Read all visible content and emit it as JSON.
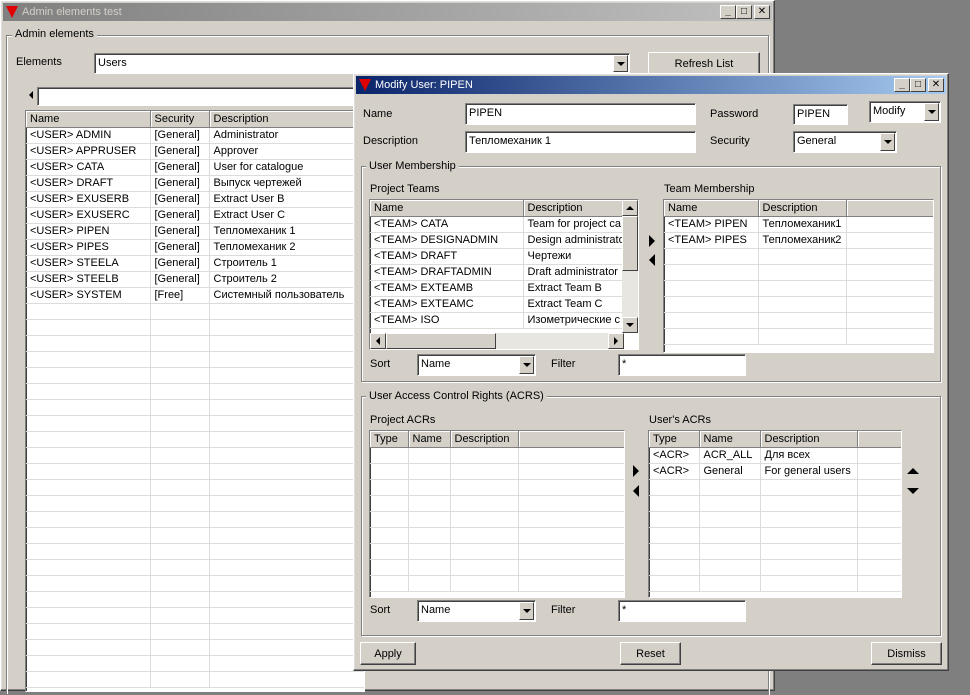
{
  "colors": {
    "title_active": "#0a246a",
    "title_inactive": "#808080",
    "face": "#d4d0c8",
    "desktop": "#7f7f7f"
  },
  "main_window": {
    "title": "Admin elements test",
    "app_icon": "red-triangle-icon",
    "group_label": "Admin elements",
    "elements_label": "Elements",
    "elements_value": "Users",
    "refresh_button": "Refresh List",
    "table": {
      "columns": [
        "Name",
        "Security",
        "Description"
      ],
      "rows": [
        [
          "<USER>  ADMIN",
          "[General]",
          "Administrator"
        ],
        [
          "<USER>  APPRUSER",
          "[General]",
          "Approver"
        ],
        [
          "<USER>  CATA",
          "[General]",
          "User for catalogue"
        ],
        [
          "<USER>  DRAFT",
          "[General]",
          "Выпуск чертежей"
        ],
        [
          "<USER>  EXUSERB",
          "[General]",
          "Extract User B"
        ],
        [
          "<USER>  EXUSERC",
          "[General]",
          "Extract User C"
        ],
        [
          "<USER>  PIPEN",
          "[General]",
          "Тепломеханик 1"
        ],
        [
          "<USER>  PIPES",
          "[General]",
          "Тепломеханик 2"
        ],
        [
          "<USER>  STEELA",
          "[General]",
          "Строитель 1"
        ],
        [
          "<USER>  STEELB",
          "[General]",
          "Строитель 2"
        ],
        [
          "<USER>  SYSTEM",
          "[Free]",
          "Системный пользователь"
        ]
      ]
    }
  },
  "dialog": {
    "title": "Modify User: PIPEN",
    "name_label": "Name",
    "name_value": "PIPEN",
    "password_label": "Password",
    "password_value": "PIPEN",
    "mode_value": "Modify",
    "description_label": "Description",
    "description_value": "Тепломеханик 1",
    "security_label": "Security",
    "security_value": "General",
    "membership": {
      "group_label": "User Membership",
      "project_teams_label": "Project Teams",
      "project_teams_columns": [
        "Name",
        "Description"
      ],
      "project_teams_rows": [
        [
          "<TEAM>  CATA",
          "Team for project ca"
        ],
        [
          "<TEAM>  DESIGNADMIN",
          "Design administrato"
        ],
        [
          "<TEAM>  DRAFT",
          "Чертежи"
        ],
        [
          "<TEAM>  DRAFTADMIN",
          "Draft administrator"
        ],
        [
          "<TEAM>  EXTEAMB",
          "Extract Team B"
        ],
        [
          "<TEAM>  EXTEAMC",
          "Extract Team C"
        ],
        [
          "<TEAM>  ISO",
          "Изометрические с"
        ]
      ],
      "team_membership_label": "Team Membership",
      "team_membership_columns": [
        "Name",
        "Description"
      ],
      "team_membership_rows": [
        [
          "<TEAM>  PIPEN",
          "Тепломеханик1"
        ],
        [
          "<TEAM>  PIPES",
          "Тепломеханик2"
        ]
      ],
      "sort_label": "Sort",
      "sort_value": "Name",
      "filter_label": "Filter",
      "filter_value": "*"
    },
    "acrs": {
      "group_label": "User Access Control Rights (ACRS)",
      "project_acrs_label": "Project ACRs",
      "project_acrs_columns": [
        "Type",
        "Name",
        "Description"
      ],
      "users_acrs_label": "User's ACRs",
      "users_acrs_columns": [
        "Type",
        "Name",
        "Description"
      ],
      "users_acrs_rows": [
        [
          "<ACR>",
          "ACR_ALL",
          "Для всех"
        ],
        [
          "<ACR>",
          "General",
          "For general users"
        ]
      ],
      "sort_label": "Sort",
      "sort_value": "Name",
      "filter_label": "Filter",
      "filter_value": "*"
    },
    "apply_button": "Apply",
    "reset_button": "Reset",
    "dismiss_button": "Dismiss"
  }
}
